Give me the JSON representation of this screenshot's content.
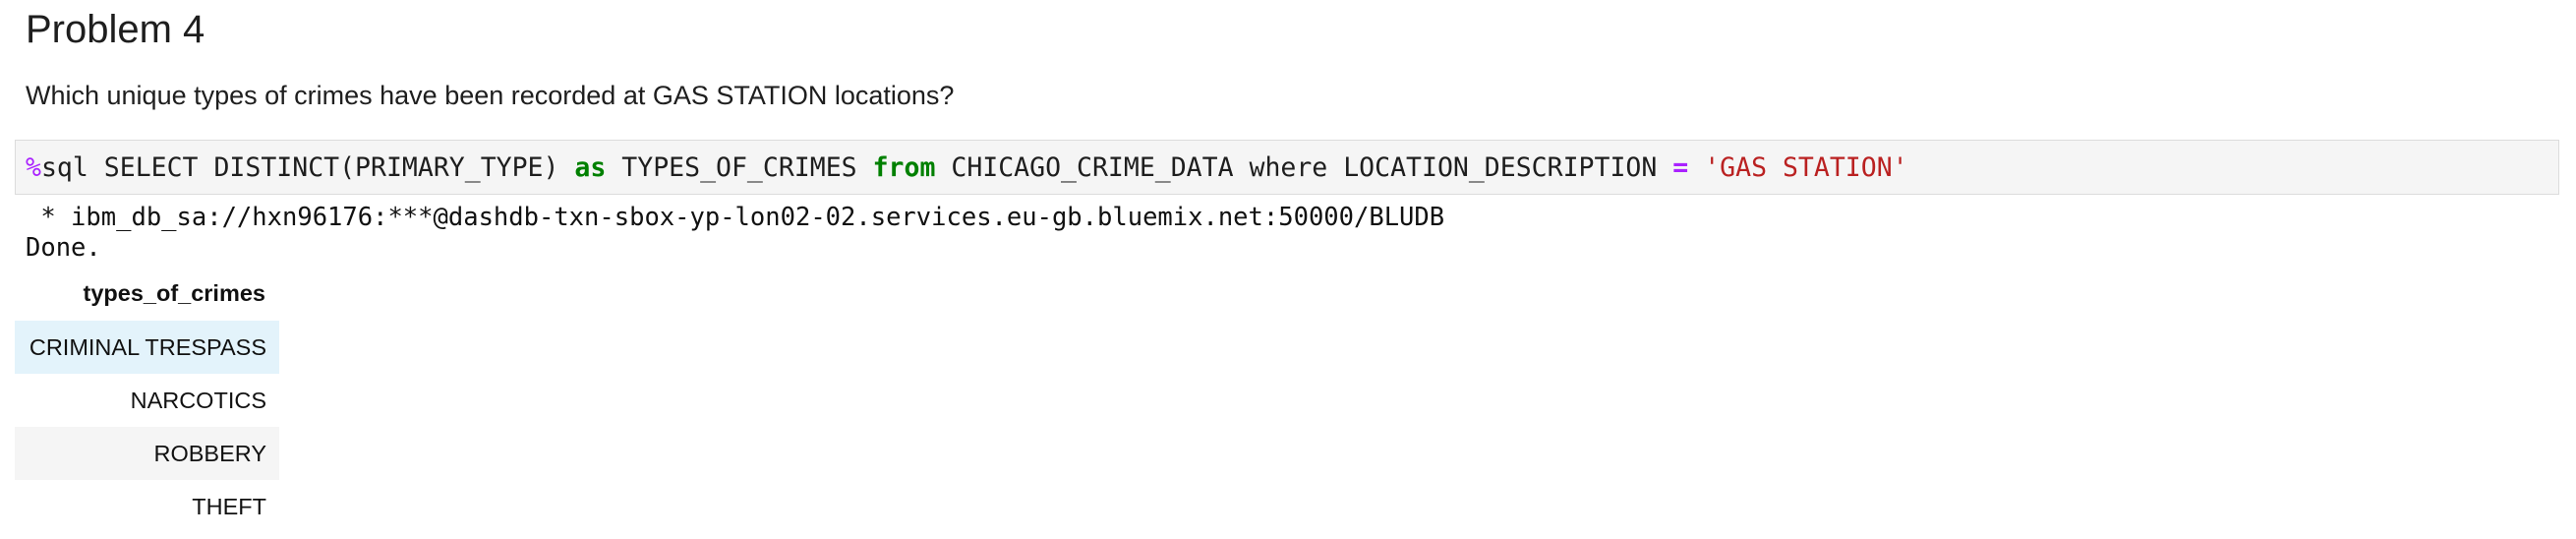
{
  "markdown": {
    "heading": "Problem 4",
    "question": "Which unique types of crimes have been recorded at GAS STATION locations?"
  },
  "code_cell": {
    "magic": "%",
    "t1": "sql SELECT DISTINCT(PRIMARY_TYPE) ",
    "kw_as": "as",
    "t2": " TYPES_OF_CRIMES ",
    "kw_from": "from",
    "t3": " CHICAGO_CRIME_DATA where LOCATION_DESCRIPTION ",
    "op_eq": "=",
    "t4": " ",
    "string_literal": "'GAS STATION'"
  },
  "output": {
    "connection_line": " * ibm_db_sa://hxn96176:***@dashdb-txn-sbox-yp-lon02-02.services.eu-gb.bluemix.net:50000/BLUDB",
    "status_line": "Done."
  },
  "result_table": {
    "header": "types_of_crimes",
    "rows": [
      "CRIMINAL TRESPASS",
      "NARCOTICS",
      "ROBBERY",
      "THEFT"
    ]
  }
}
